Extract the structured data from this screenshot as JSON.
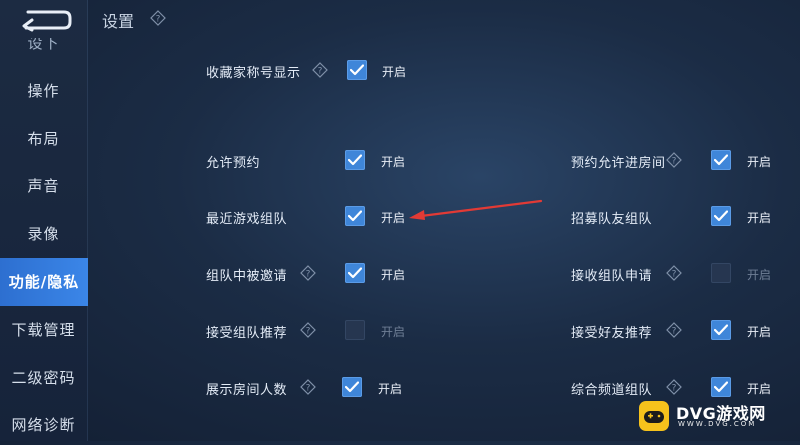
{
  "header": {
    "title": "设置"
  },
  "sidebar": {
    "items": [
      {
        "label": "设下",
        "id": "cut"
      },
      {
        "label": "操作",
        "id": "controls"
      },
      {
        "label": "布局",
        "id": "layout"
      },
      {
        "label": "声音",
        "id": "sound"
      },
      {
        "label": "录像",
        "id": "recording"
      },
      {
        "label": "功能/隐私",
        "id": "features-privacy",
        "active": true
      },
      {
        "label": "下载管理",
        "id": "download"
      },
      {
        "label": "二级密码",
        "id": "secondary-password"
      },
      {
        "label": "网络诊断",
        "id": "network"
      }
    ]
  },
  "settings": {
    "collector_title": {
      "label": "收藏家称号显示",
      "checked": true,
      "state": "开启"
    },
    "allow_reservation": {
      "label": "允许预约",
      "checked": true,
      "state": "开启"
    },
    "reservation_join_room": {
      "label": "预约允许进房间",
      "checked": true,
      "state": "开启"
    },
    "recent_game_team": {
      "label": "最近游戏组队",
      "checked": true,
      "state": "开启"
    },
    "recruit_team": {
      "label": "招募队友组队",
      "checked": true,
      "state": "开启"
    },
    "invited_in_team": {
      "label": "组队中被邀请",
      "checked": true,
      "state": "开启"
    },
    "receive_team_request": {
      "label": "接收组队申请",
      "checked": false,
      "state": "开启"
    },
    "accept_team_recommend": {
      "label": "接受组队推荐",
      "checked": false,
      "state": "开启"
    },
    "accept_friend_recommend": {
      "label": "接受好友推荐",
      "checked": true,
      "state": "开启"
    },
    "show_room_count": {
      "label": "展示房间人数",
      "checked": true,
      "state": "开启"
    },
    "general_channel_team": {
      "label": "综合频道组队",
      "checked": true,
      "state": "开启"
    }
  },
  "watermark": {
    "brand": "DVG游戏网",
    "sub": "WWW.DVG.COM"
  },
  "colors": {
    "accent": "#3f86d9",
    "active_tab": "#3b86e8",
    "arrow": "#e23a35"
  }
}
